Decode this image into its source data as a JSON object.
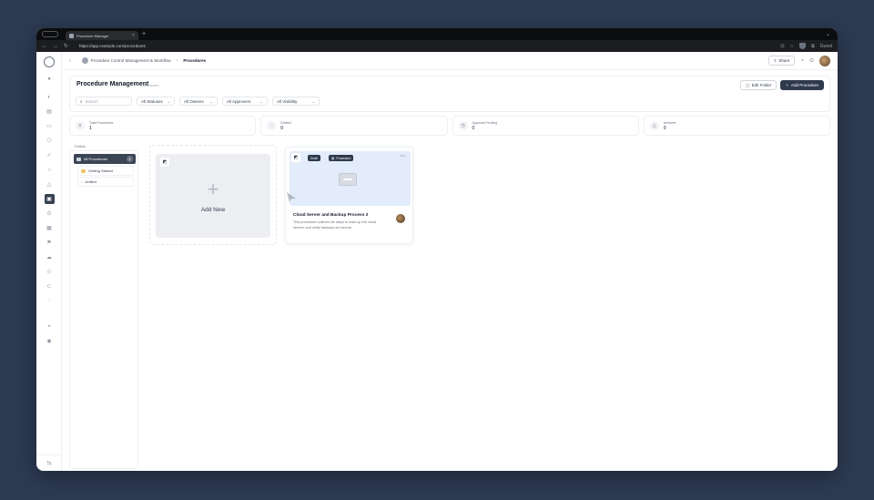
{
  "browser": {
    "tab_title": "Procedure Manager",
    "tab_close": "×",
    "new_tab": "+",
    "url": "https://app.example.com/procedures",
    "right_user": "Guest"
  },
  "topbar": {
    "org_name": "Procedure Control Management & Workflow",
    "current_page": "Procedures",
    "share_label": "Share"
  },
  "header": {
    "title": "Procedure Management",
    "subtitle": "Procedures",
    "secondary_button": "Edit Folder",
    "primary_button": "Add Procedure",
    "search_placeholder": "Search",
    "filters": [
      "All Statuses",
      "All Owners",
      "All Approvers",
      "All Visibility"
    ]
  },
  "stats": [
    {
      "label": "Total Procedures",
      "value": "1",
      "icon": "list-icon"
    },
    {
      "label": "Drafted",
      "value": "0",
      "icon": "draft-icon"
    },
    {
      "label": "Approval Pending",
      "value": "0",
      "icon": "clock-icon"
    },
    {
      "label": "Archived",
      "value": "0",
      "icon": "archive-icon"
    }
  ],
  "folders": {
    "heading": "Folders",
    "selected": "All Procedures",
    "selected_count": "1",
    "sub_items": [
      "Getting Started",
      "Unfiled"
    ]
  },
  "add_card": {
    "label": "Add New",
    "plus": "+"
  },
  "procedure_card": {
    "tags": [
      "Draft",
      "Procedure"
    ],
    "title": "Cloud Server and Backup Process",
    "title_num": "2",
    "description": "This procedure outlines the steps to back up the cloud servers and verify backups are secure."
  },
  "icons": {
    "rail": [
      "home-icon",
      "dashboard-icon",
      "chart-icon",
      "document-icon",
      "shield-icon",
      "check-icon",
      "bell-icon",
      "user-icon",
      "procedure-icon",
      "settings-icon",
      "calendar-icon",
      "flag-icon",
      "cloud-icon",
      "tag-icon",
      "database-icon",
      "help-icon",
      "plugin-icon",
      "gear-icon"
    ]
  }
}
